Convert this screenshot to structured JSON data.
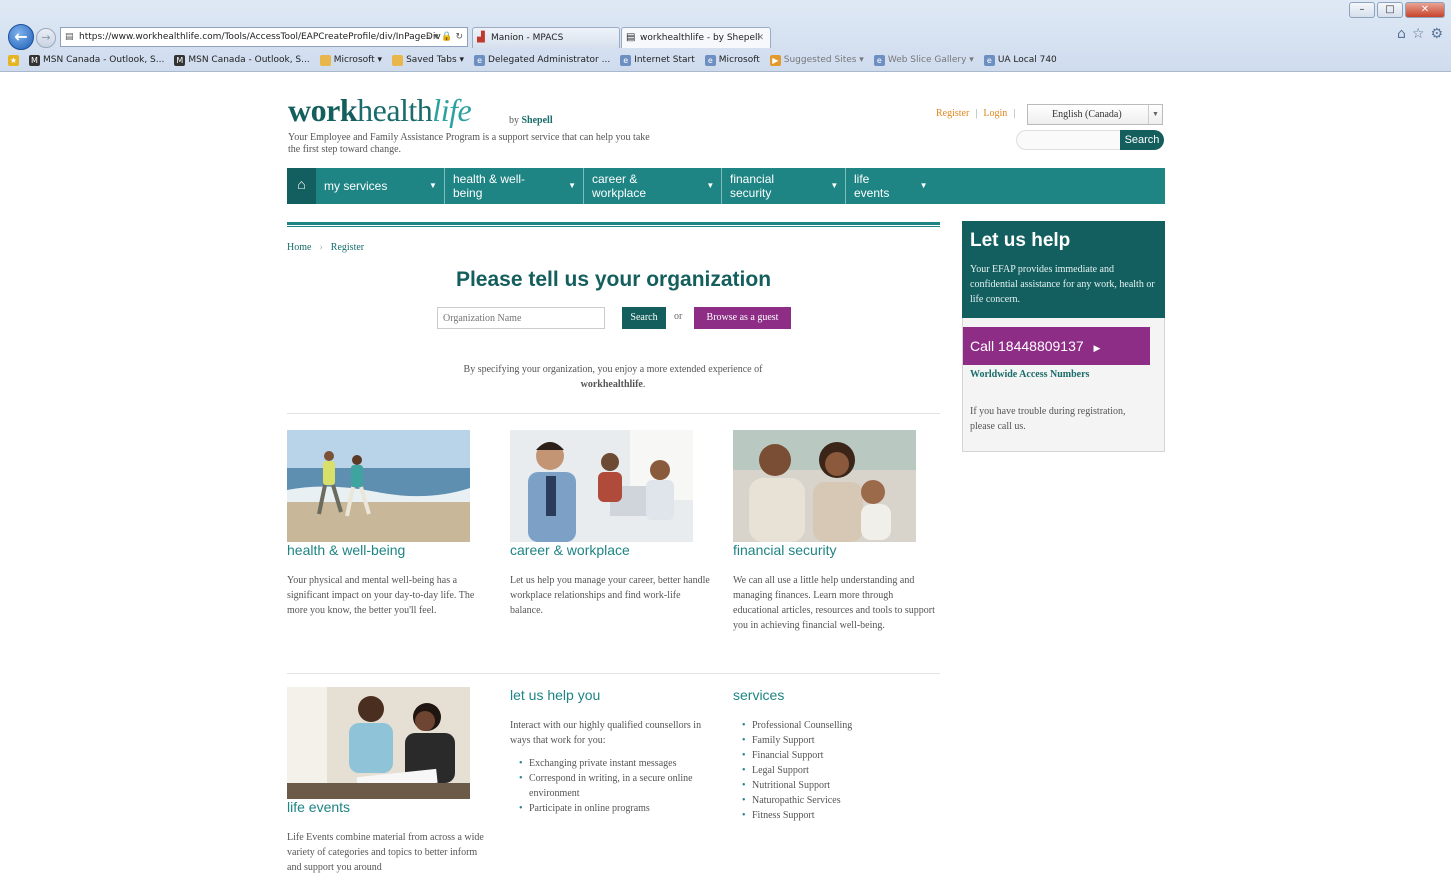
{
  "browser": {
    "address": "https://www.workhealthlife.com/Tools/AccessTool/EAPCreateProfile/div/InPageDiv",
    "tabs": [
      {
        "label": "Manion - MPACS"
      },
      {
        "label": "workhealthlife - by Shepell"
      }
    ],
    "favorites": [
      {
        "label": "MSN Canada - Outlook, S..."
      },
      {
        "label": "MSN Canada - Outlook, S..."
      },
      {
        "label": "Microsoft ▾"
      },
      {
        "label": "Saved Tabs ▾"
      },
      {
        "label": "Delegated Administrator ..."
      },
      {
        "label": "Internet Start"
      },
      {
        "label": "Microsoft"
      },
      {
        "label": "Suggested Sites ▾"
      },
      {
        "label": "Web Slice Gallery ▾"
      },
      {
        "label": "UA Local 740"
      }
    ]
  },
  "header": {
    "logo_work": "work",
    "logo_health": "health",
    "logo_life": "life",
    "byline_prefix": "by",
    "byline_brand": "Shepell",
    "tagline": "Your Employee and Family Assistance Program is a support service that can help you take the first step toward change.",
    "register": "Register",
    "login": "Login",
    "language": "English (Canada)",
    "search_button": "Search"
  },
  "nav": {
    "items": [
      {
        "label": "my services"
      },
      {
        "label": "health & well-being"
      },
      {
        "label": "career & workplace"
      },
      {
        "label": "financial security"
      },
      {
        "label": "life events"
      }
    ]
  },
  "breadcrumb": {
    "home": "Home",
    "current": "Register"
  },
  "org": {
    "title": "Please tell us your organization",
    "placeholder": "Organization Name",
    "search_label": "Search",
    "or": "or",
    "guest_label": "Browse as a guest",
    "note_prefix": "By specifying your organization, you enjoy a more extended experience of ",
    "note_brand": "workhealthlife",
    "note_suffix": "."
  },
  "cards": [
    {
      "title": "health & well-being",
      "text": "Your physical and mental well-being has a significant impact on your day-to-day life. The more you know, the better you'll feel."
    },
    {
      "title": "career & workplace",
      "text": "Let us help you manage your career, better handle workplace relationships and find work-life balance."
    },
    {
      "title": "financial security",
      "text": "We can all use a little help understanding and managing finances. Learn more through educational articles, resources and tools to support you in achieving financial well-being."
    },
    {
      "title": "life events",
      "text": "Life Events combine material from across a wide variety of categories and topics to better inform and support you around"
    }
  ],
  "help_you": {
    "title": "let us help you",
    "intro": "Interact with our highly qualified counsellors in ways that work for you:",
    "items": [
      "Exchanging private instant messages",
      "Correspond in writing, in a secure online environment",
      "Participate in online programs"
    ]
  },
  "services": {
    "title": "services",
    "items": [
      "Professional Counselling",
      "Family Support",
      "Financial Support",
      "Legal Support",
      "Nutritional Support",
      "Naturopathic Services",
      "Fitness Support"
    ]
  },
  "sidebar": {
    "title": "Let us help",
    "desc": "Your EFAP provides immediate and confidential assistance for any work, health or life concern.",
    "call": "Call 18448809137",
    "worldwide": "Worldwide Access Numbers",
    "note": "If you have trouble during registration, please call us."
  },
  "colors": {
    "teal": "#1e8484",
    "dark_teal": "#135f5f",
    "purple": "#8e2d85",
    "orange": "#e0871d"
  }
}
